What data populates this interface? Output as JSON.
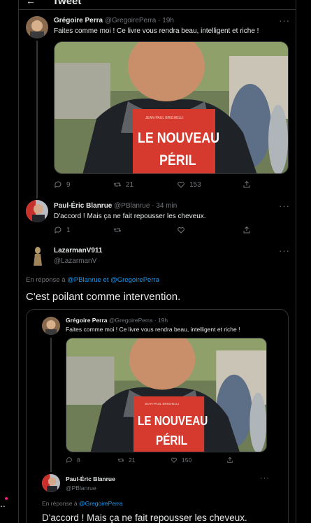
{
  "header": {
    "title": "Tweet",
    "back_glyph": "←"
  },
  "tweet1": {
    "author_name": "Grégoire Perra",
    "meta": "@GregoirePerra · 19h",
    "text": "Faites comme moi ! Ce livre vous rendra beau, intelligent et riche !",
    "book": {
      "top_line": "JEAN-PAUL BRIGHELLI",
      "title1": "LE NOUVEAU",
      "title2": "PÉRIL"
    },
    "replies": "9",
    "retweets": "21",
    "likes": "153"
  },
  "tweet2": {
    "author_name": "Paul-Éric Blanrue",
    "meta": "@PBlanrue · 34 min",
    "text": "D'accord ! Mais ça ne fait repousser les cheveux.",
    "replies": "1"
  },
  "main": {
    "author_name": "LazarmanV911",
    "handle": "@LazarmanV",
    "reply_prefix": "En réponse à",
    "reply_user1": "@PBlanrue",
    "reply_and": "et",
    "reply_user2": "@GregoirePerra",
    "text": "C'est poilant comme intervention."
  },
  "quote": {
    "tweet1": {
      "author_name": "Grégoire Perra",
      "meta": "@GregoirePerra · 19h",
      "text": "Faites comme moi ! Ce livre vous rendra beau, intelligent et riche !",
      "replies": "8",
      "retweets": "21",
      "likes": "150"
    },
    "tweet2": {
      "author_name": "Paul-Éric Blanrue",
      "handle": "@PBlanrue",
      "reply_prefix": "En réponse à",
      "reply_user": "@GregoirePerra",
      "text": "D'accord ! Mais ça ne fait repousser les cheveux."
    }
  },
  "more_glyph": "···",
  "colors": {
    "background": "#000000",
    "link": "#1d9bf0",
    "muted": "#71767b",
    "border": "#2f3336",
    "book_red": "#d63a2f"
  }
}
